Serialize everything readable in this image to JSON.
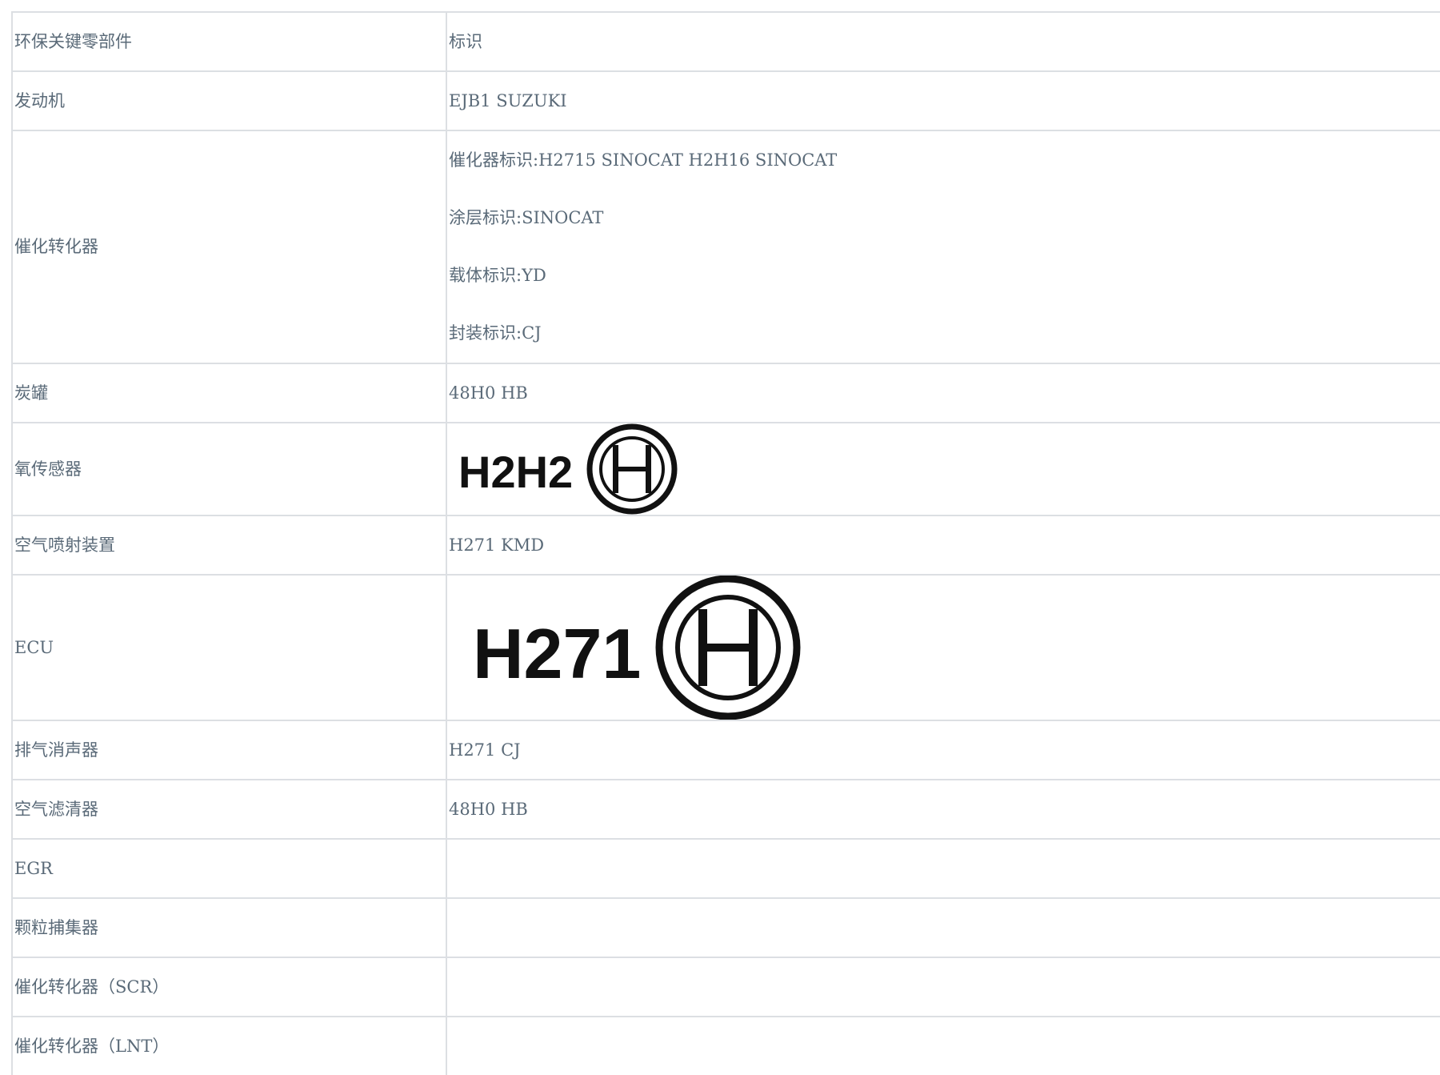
{
  "table": {
    "header": {
      "col1": "环保关键零部件",
      "col2": "标识"
    },
    "rows": [
      {
        "part": "发动机",
        "mark": "EJB1 SUZUKI"
      },
      {
        "part": "催化转化器",
        "marks": [
          "催化器标识:H2715 SINOCAT H2H16 SINOCAT",
          "涂层标识:SINOCAT",
          "载体标识:YD",
          "封装标识:CJ"
        ]
      },
      {
        "part": "炭罐",
        "mark": "48H0 HB"
      },
      {
        "part": "氧传感器",
        "logo": {
          "text": "H2H2",
          "icon": "bosch-logo-icon"
        }
      },
      {
        "part": "空气喷射装置",
        "mark": "H271 KMD"
      },
      {
        "part": "ECU",
        "logo": {
          "text": "H271",
          "icon": "bosch-logo-icon"
        }
      },
      {
        "part": "排气消声器",
        "mark": "H271 CJ"
      },
      {
        "part": "空气滤清器",
        "mark": "48H0 HB"
      },
      {
        "part": "EGR",
        "mark": ""
      },
      {
        "part": "颗粒捕集器",
        "mark": ""
      },
      {
        "part": "催化转化器（SCR）",
        "mark": ""
      },
      {
        "part": "催化转化器（LNT）",
        "mark": ""
      }
    ]
  }
}
